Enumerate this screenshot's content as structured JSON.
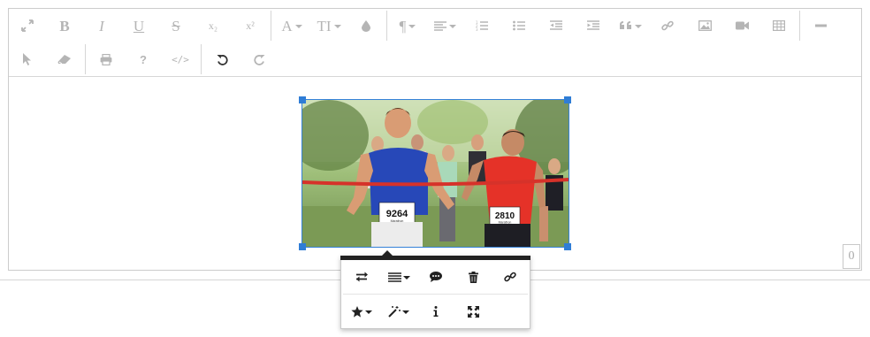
{
  "toolbar": {
    "row1": [
      {
        "name": "fullscreen-button",
        "icon": "expand-arrows-icon",
        "label": ""
      },
      {
        "name": "bold-button",
        "icon": "bold-icon",
        "label": "B"
      },
      {
        "name": "italic-button",
        "icon": "italic-icon",
        "label": "I"
      },
      {
        "name": "underline-button",
        "icon": "underline-icon",
        "label": "U"
      },
      {
        "name": "strikethrough-button",
        "icon": "strikethrough-icon",
        "label": "S"
      },
      {
        "name": "subscript-button",
        "icon": "subscript-icon",
        "label": "x₂"
      },
      {
        "name": "superscript-button",
        "icon": "superscript-icon",
        "label": "x²"
      },
      {
        "name": "font-family-button",
        "icon": "font-icon",
        "label": "A"
      },
      {
        "name": "font-size-button",
        "icon": "text-height-icon",
        "label": "TI"
      },
      {
        "name": "color-button",
        "icon": "droplet-icon",
        "label": ""
      },
      {
        "name": "paragraph-button",
        "icon": "pilcrow-icon",
        "label": "¶"
      },
      {
        "name": "align-button",
        "icon": "align-left-icon",
        "label": ""
      },
      {
        "name": "ordered-list-button",
        "icon": "ordered-list-icon",
        "label": ""
      },
      {
        "name": "unordered-list-button",
        "icon": "unordered-list-icon",
        "label": ""
      },
      {
        "name": "outdent-button",
        "icon": "outdent-icon",
        "label": ""
      },
      {
        "name": "indent-button",
        "icon": "indent-icon",
        "label": ""
      },
      {
        "name": "quote-button",
        "icon": "quote-icon",
        "label": ""
      },
      {
        "name": "insert-link-button",
        "icon": "link-icon",
        "label": ""
      },
      {
        "name": "insert-image-button",
        "icon": "image-icon",
        "label": ""
      },
      {
        "name": "insert-video-button",
        "icon": "video-camera-icon",
        "label": ""
      },
      {
        "name": "insert-table-button",
        "icon": "table-icon",
        "label": ""
      },
      {
        "name": "horizontal-line-button",
        "icon": "minus-icon",
        "label": ""
      }
    ],
    "row2": [
      {
        "name": "select-all-button",
        "icon": "cursor-icon",
        "label": ""
      },
      {
        "name": "clear-formatting-button",
        "icon": "eraser-icon",
        "label": ""
      },
      {
        "name": "print-button",
        "icon": "print-icon",
        "label": ""
      },
      {
        "name": "help-button",
        "icon": "question-icon",
        "label": "?"
      },
      {
        "name": "html-view-button",
        "icon": "code-icon",
        "label": "</>"
      },
      {
        "name": "undo-button",
        "icon": "undo-icon",
        "label": ""
      },
      {
        "name": "redo-button",
        "icon": "redo-icon",
        "label": ""
      }
    ]
  },
  "image": {
    "alt_icon": "marathon-finish-photo",
    "bibs": [
      "9264",
      "2810"
    ],
    "bib_caption": "Marathon"
  },
  "counter": {
    "value": "0"
  },
  "image_popover": {
    "row1": [
      {
        "name": "replace-image-button",
        "icon": "swap-icon"
      },
      {
        "name": "align-image-button",
        "icon": "align-icon"
      },
      {
        "name": "image-caption-button",
        "icon": "comment-icon"
      },
      {
        "name": "remove-image-button",
        "icon": "trash-icon"
      },
      {
        "name": "image-link-button",
        "icon": "link-icon"
      }
    ],
    "row2": [
      {
        "name": "image-style-button",
        "icon": "star-icon"
      },
      {
        "name": "image-effects-button",
        "icon": "magic-wand-icon"
      },
      {
        "name": "image-alt-button",
        "icon": "info-icon"
      },
      {
        "name": "image-size-button",
        "icon": "fullsize-icon"
      }
    ]
  },
  "colors": {
    "accent": "#3582d8",
    "icon_inactive": "#b5b5b5",
    "icon_active": "#333333"
  }
}
